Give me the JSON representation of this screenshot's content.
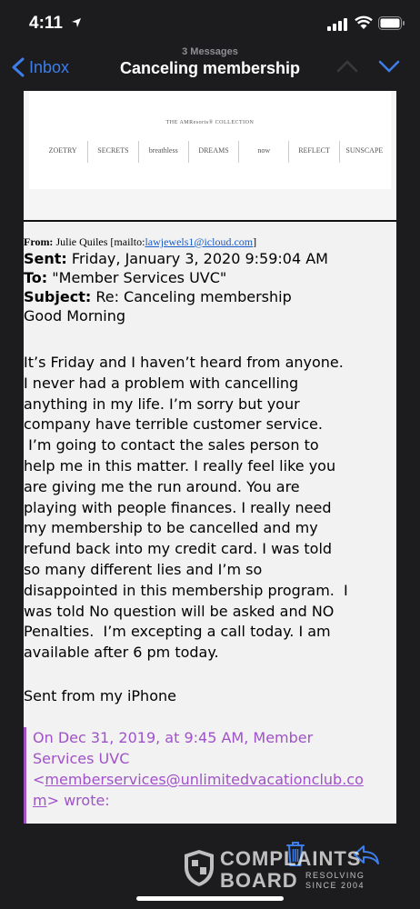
{
  "status_bar": {
    "time": "4:11",
    "icons": [
      "location-arrow-icon",
      "cellular-signal-icon",
      "wifi-icon",
      "battery-icon"
    ]
  },
  "nav": {
    "back_label": "Inbox",
    "subtitle": "3 Messages",
    "title": "Canceling membership",
    "accent_color": "#3d7eea"
  },
  "banner": {
    "heading": "THE AMResorts® COLLECTION",
    "brands": [
      "ZOETRY",
      "SECRETS",
      "breathless",
      "DREAMS",
      "now",
      "REFLECT",
      "SUNSCAPE"
    ]
  },
  "email": {
    "from_label": "From:",
    "from_name": "Julie Quiles [mailto:",
    "from_email": "lawjewels1@icloud.com",
    "from_close": "]",
    "sent_label": "Sent:",
    "sent_value": "Friday, January 3, 2020 9:59:04 AM",
    "to_label": "To:",
    "to_value": "\"Member Services UVC\"",
    "subject_label": "Subject:",
    "subject_value": "Re: Canceling membership",
    "greeting": "Good Morning",
    "body_lines": [
      "It’s Friday and I haven’t heard from anyone.",
      "I never had a problem with cancelling",
      "anything in my life. I’m sorry but your",
      "company have terrible customer service.",
      " I’m going to contact the sales person to",
      "help me in this matter. I really feel like you",
      "are giving me the run around. You are",
      "playing with people finances. I really need",
      "my membership to be cancelled and my",
      "refund back into my credit card. I was told",
      "so many different lies and I’m so",
      "disappointed in this membership program.  I",
      "was told No question will be asked and NO",
      "Penalties.  I’m excepting a call today. I am",
      "available after 6 pm today."
    ],
    "signature": "Sent from my iPhone",
    "quote_line1": "On Dec 31, 2019, at 9:45 AM, Member",
    "quote_line2": "Services UVC",
    "quote_prefix": "<",
    "quote_email_part1": "memberservices@unlimitedvacationclub.co",
    "quote_email_part2": "m",
    "quote_suffix": "> wrote:",
    "quote_color": "#a052c8"
  },
  "toolbar": {
    "icons": [
      "trash-icon",
      "reply-icon"
    ]
  },
  "watermark": {
    "line1": "COMPLAINTS",
    "line2": "BOARD",
    "tag1": "RESOLVING",
    "tag2": "SINCE 2004"
  }
}
